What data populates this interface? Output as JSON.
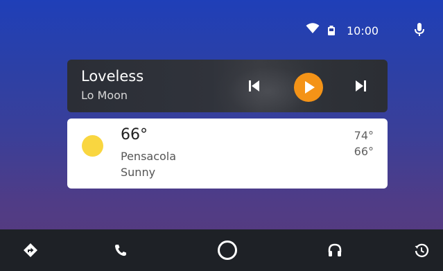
{
  "status_bar": {
    "time": "10:00",
    "icons": [
      "wifi-icon",
      "battery-icon",
      "mic-icon"
    ]
  },
  "media": {
    "title": "Loveless",
    "artist": "Lo Moon",
    "controls": [
      "skip-previous-icon",
      "play-icon",
      "skip-next-icon"
    ],
    "accent_color": "#f49317"
  },
  "weather": {
    "temperature": "66°",
    "city": "Pensacola",
    "condition": "Sunny",
    "high": "74°",
    "low": "66°",
    "icon": "sun-icon",
    "icon_color": "#f9d640"
  },
  "nav": {
    "items": [
      "navigation-icon",
      "phone-icon",
      "home-icon",
      "headphones-icon",
      "recents-icon"
    ]
  },
  "colors": {
    "background_top": "#1f3fb8",
    "background_bottom": "#5a3a7a",
    "nav_bar": "#1e2126"
  }
}
